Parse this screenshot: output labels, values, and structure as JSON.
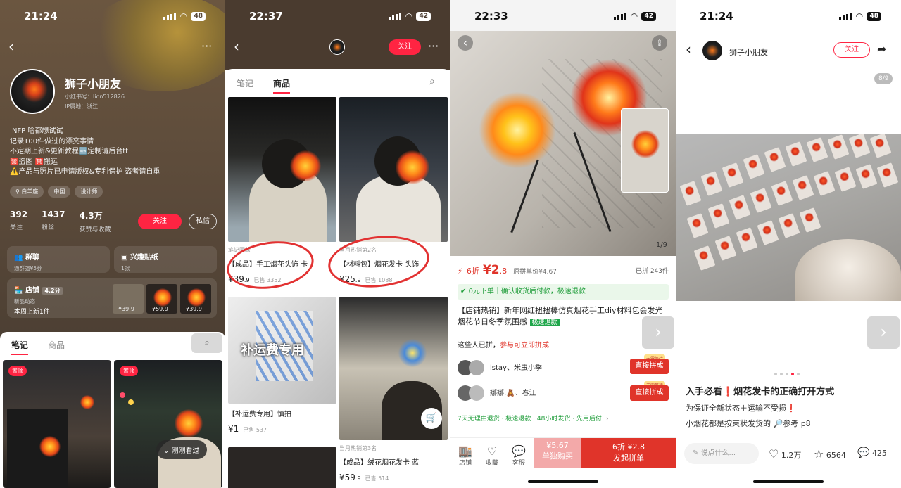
{
  "panel1": {
    "status": {
      "time": "21:24",
      "battery": "48"
    },
    "name": "狮子小朋友",
    "red_id": "小红书号：lion512826",
    "ip": "IP属地：浙江",
    "bio": [
      "INFP 啥都想试试",
      "记录100件做过的漂亮事情",
      "不定期上新&更新教程🆕定制请后台tt",
      "🈲盗图 🈲搬运",
      "⚠️产品与照片已申请版权&专利保护 盗者请自重"
    ],
    "tags": [
      "♀ 白羊座",
      "中国",
      "设计师"
    ],
    "stats": [
      {
        "num": "392",
        "label": "关注"
      },
      {
        "num": "1437",
        "label": "粉丝"
      },
      {
        "num": "4.3万",
        "label": "获赞与收藏"
      }
    ],
    "follow_label": "关注",
    "message_label": "私信",
    "group_chat": {
      "title": "群聊",
      "sub": "通群强¥5券"
    },
    "stickers": {
      "title": "兴趣贴纸",
      "sub": "1张"
    },
    "shop": {
      "title": "店铺",
      "rating": "4.2分",
      "sub1": "新品动态",
      "sub2": "本周上新1件"
    },
    "shop_prices": [
      "¥39.9",
      "¥59.9",
      "¥39.9"
    ],
    "tabs": [
      "笔记",
      "商品"
    ],
    "pin_label": "置顶",
    "recent_label": "刚刚看过"
  },
  "panel2": {
    "status": {
      "time": "22:37",
      "battery": "42"
    },
    "follow_label": "关注",
    "tabs": [
      "笔记",
      "商品"
    ],
    "products": [
      {
        "sub": "笔记同款",
        "title": "【成品】手工烟花头饰 卡",
        "price": "¥39",
        "price_dec": ".9",
        "sold": "已售 3352"
      },
      {
        "sub": "当月热销第2名",
        "title": "【材料包】烟花发卡 头饰",
        "price": "¥25",
        "price_dec": ".9",
        "sold": "已售 1088"
      },
      {
        "sub": "",
        "title": "【补运费专用】慎拍",
        "price": "¥1",
        "price_dec": "",
        "sold": "已售 537"
      },
      {
        "sub": "当月热销第3名",
        "title": "【成品】绒花烟花发卡 蓝",
        "price": "¥59",
        "price_dec": ".9",
        "sold": "已售 514"
      }
    ],
    "shipping_overlay": "补运费专用"
  },
  "panel3": {
    "status": {
      "time": "22:33",
      "battery": "42"
    },
    "image_counter": "1/9",
    "discount": "6折",
    "price": "¥2",
    "price_dec": ".8",
    "orig_price": "原拼单价¥4.67",
    "sold": "已拼 243件",
    "promo": "0元下单｜确认收货后付款，极速退款",
    "title": "【店铺热销】新年网红扭扭棒仿真烟花手工diy材料包会发光烟花节日冬季氛围感",
    "fast_refund": "极速退款",
    "group_hint_a": "这些人已拼，",
    "group_hint_b": "参与可立即拼成",
    "groups": [
      {
        "names": "lstay、米虫小季",
        "tag": "无需等待",
        "btn": "直接拼成"
      },
      {
        "names": "娜娜.🧸、春江",
        "tag": "无需等待",
        "btn": "直接拼成"
      }
    ],
    "guarantees": "7天无理由退货 · 极速退款 · 48小时发货 · 先用后付",
    "bottom": {
      "shop": "店铺",
      "collect": "收藏",
      "service": "客服",
      "single_price": "¥5.67",
      "single_label": "单独购买",
      "group_price": "6折 ¥2.8",
      "group_label": "发起拼单"
    }
  },
  "panel4": {
    "status": {
      "time": "21:24",
      "battery": "48"
    },
    "author": "狮子小朋友",
    "follow_label": "关注",
    "counter": "8/9",
    "title": "入手必看❗️烟花发卡的正确打开方式",
    "line1": "为保证全新状态＋运输不受损❗️",
    "line2": "小烟花都是按束状发货的 🔎参考 p8",
    "comment_placeholder": "说点什么...",
    "likes": "1.2万",
    "stars": "6564",
    "comments": "425"
  }
}
